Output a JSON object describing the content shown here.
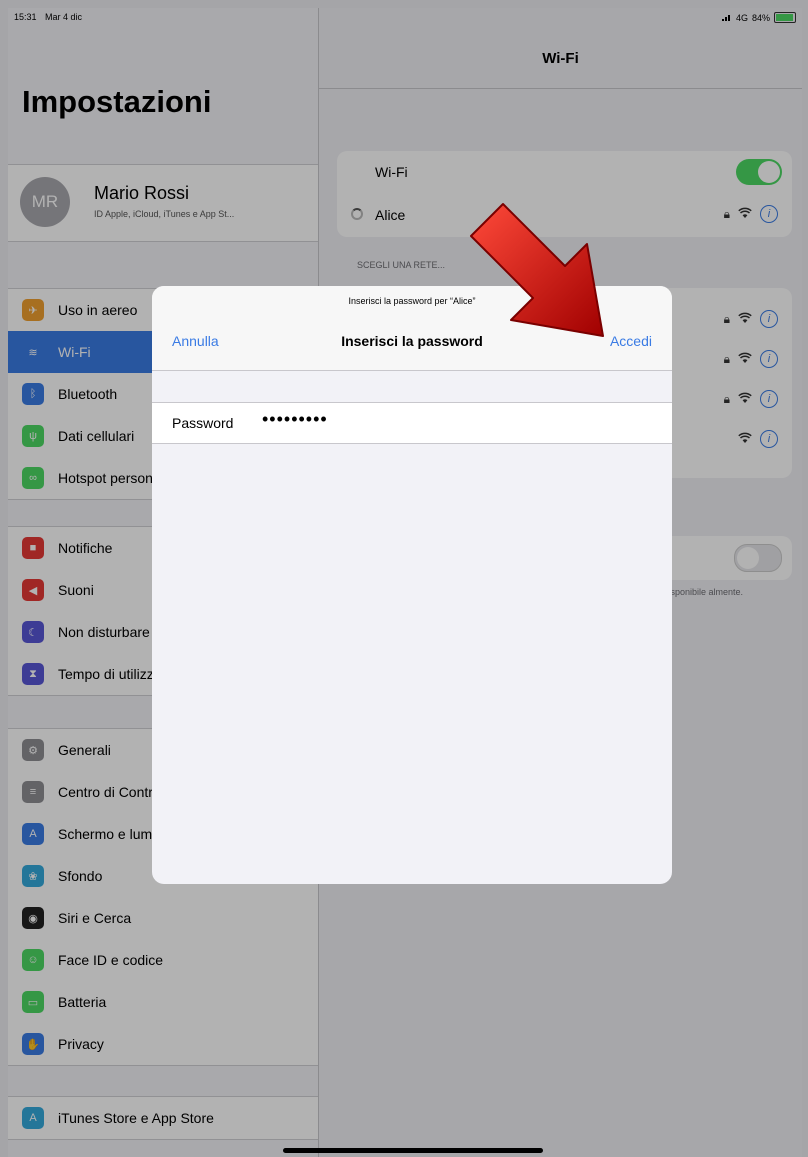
{
  "status_bar": {
    "time": "15:31",
    "date": "Mar 4 dic",
    "network": "4G",
    "battery": "84%",
    "battery_level": 0.84
  },
  "sidebar": {
    "title": "Impostazioni",
    "profile": {
      "initials": "MR",
      "name": "Mario Rossi",
      "subtitle": "ID Apple, iCloud, iTunes e App St..."
    },
    "groups": [
      [
        {
          "label": "Uso in aereo",
          "icon": "airplane-icon",
          "color": "#f0a030"
        },
        {
          "label": "Wi-Fi",
          "icon": "wifi-icon",
          "color": "#3a7be4",
          "selected": true
        },
        {
          "label": "Bluetooth",
          "icon": "bluetooth-icon",
          "color": "#3a7be4"
        },
        {
          "label": "Dati cellulari",
          "icon": "antenna-icon",
          "color": "#4cd964"
        },
        {
          "label": "Hotspot personale",
          "icon": "hotspot-icon",
          "color": "#4cd964"
        }
      ],
      [
        {
          "label": "Notifiche",
          "icon": "notifications-icon",
          "color": "#e53935"
        },
        {
          "label": "Suoni",
          "icon": "speaker-icon",
          "color": "#e53935"
        },
        {
          "label": "Non disturbare",
          "icon": "moon-icon",
          "color": "#5856d6"
        },
        {
          "label": "Tempo di utilizzo",
          "icon": "hourglass-icon",
          "color": "#5856d6"
        }
      ],
      [
        {
          "label": "Generali",
          "icon": "gear-icon",
          "color": "#8e8e93"
        },
        {
          "label": "Centro di Controllo",
          "icon": "switches-icon",
          "color": "#8e8e93"
        },
        {
          "label": "Schermo e luminosità",
          "icon": "text-size-icon",
          "color": "#3a7be4"
        },
        {
          "label": "Sfondo",
          "icon": "wallpaper-icon",
          "color": "#34aadc"
        },
        {
          "label": "Siri e Cerca",
          "icon": "siri-icon",
          "color": "#222222"
        },
        {
          "label": "Face ID e codice",
          "icon": "face-id-icon",
          "color": "#4cd964"
        },
        {
          "label": "Batteria",
          "icon": "battery-icon",
          "color": "#4cd964"
        },
        {
          "label": "Privacy",
          "icon": "hand-icon",
          "color": "#3a7be4"
        }
      ],
      [
        {
          "label": "iTunes Store e App Store",
          "icon": "app-store-icon",
          "color": "#34aadc"
        }
      ]
    ]
  },
  "detail": {
    "title": "Wi-Fi",
    "wifi_label": "Wi-Fi",
    "wifi_on": true,
    "current_network": "Alice",
    "section_header": "SCEGLI UNA RETE...",
    "ask_note": "i disponibile almente."
  },
  "modal": {
    "prompt": "Inserisci la password per “Alice”",
    "cancel": "Annulla",
    "title": "Inserisci la password",
    "join": "Accedi",
    "field_label": "Password",
    "field_value": "•••••••••"
  },
  "annotation_arrow": {
    "color": "#d60000",
    "points_to": "Accedi"
  }
}
